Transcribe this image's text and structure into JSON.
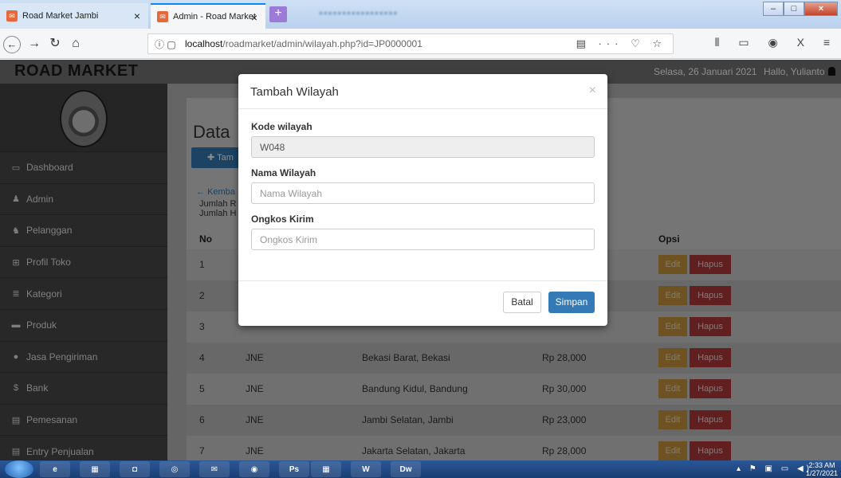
{
  "browser": {
    "tabs": [
      {
        "label": "Road Market Jambi",
        "active": false
      },
      {
        "label": "Admin - Road Market",
        "active": true
      }
    ],
    "url_prefix": "localhost",
    "url_path": "/roadmarket/admin/wilayah.php?id=JP0000001"
  },
  "app": {
    "brand": "ROAD MARKET",
    "date": "Selasa, 26 Januari 2021",
    "greeting": "Hallo, Yulianto"
  },
  "sidebar": {
    "items": [
      {
        "label": "Dashboard",
        "icon": "monitor-icon"
      },
      {
        "label": "Admin",
        "icon": "user-icon"
      },
      {
        "label": "Pelanggan",
        "icon": "users-icon"
      },
      {
        "label": "Profil Toko",
        "icon": "table-icon"
      },
      {
        "label": "Kategori",
        "icon": "list-icon"
      },
      {
        "label": "Produk",
        "icon": "briefcase-icon"
      },
      {
        "label": "Jasa Pengiriman",
        "icon": "map-marker-icon"
      },
      {
        "label": "Bank",
        "icon": "dollar-icon"
      },
      {
        "label": "Pemesanan",
        "icon": "credit-card-icon"
      },
      {
        "label": "Entry Penjualan",
        "icon": "credit-card-icon"
      }
    ]
  },
  "main": {
    "title_visible": "Data",
    "add_button": "Tam",
    "back_link": "Kemba",
    "jumlah1": "Jumlah R",
    "jumlah2": "Jumlah H",
    "columns": {
      "no": "No",
      "opsi": "Opsi"
    },
    "rows": [
      {
        "no": "1",
        "jasa": "",
        "wilayah": "",
        "ongkos": ""
      },
      {
        "no": "2",
        "jasa": "",
        "wilayah": "",
        "ongkos": ""
      },
      {
        "no": "3",
        "jasa": "",
        "wilayah": "",
        "ongkos": ""
      },
      {
        "no": "4",
        "jasa": "JNE",
        "wilayah": "Bekasi Barat, Bekasi",
        "ongkos": "Rp 28,000"
      },
      {
        "no": "5",
        "jasa": "JNE",
        "wilayah": "Bandung Kidul, Bandung",
        "ongkos": "Rp 30,000"
      },
      {
        "no": "6",
        "jasa": "JNE",
        "wilayah": "Jambi Selatan, Jambi",
        "ongkos": "Rp 23,000"
      },
      {
        "no": "7",
        "jasa": "JNE",
        "wilayah": "Jakarta Selatan, Jakarta",
        "ongkos": "Rp 28,000"
      }
    ],
    "edit_label": "Edit",
    "delete_label": "Hapus"
  },
  "modal": {
    "title": "Tambah Wilayah",
    "close": "×",
    "kode_label": "Kode wilayah",
    "kode_value": "W048",
    "nama_label": "Nama Wilayah",
    "nama_placeholder": "Nama Wilayah",
    "ongkos_label": "Ongkos Kirim",
    "ongkos_placeholder": "Ongkos Kirim",
    "cancel": "Batal",
    "save": "Simpan"
  },
  "taskbar": {
    "time": "2:33 AM",
    "date": "1/27/2021"
  }
}
